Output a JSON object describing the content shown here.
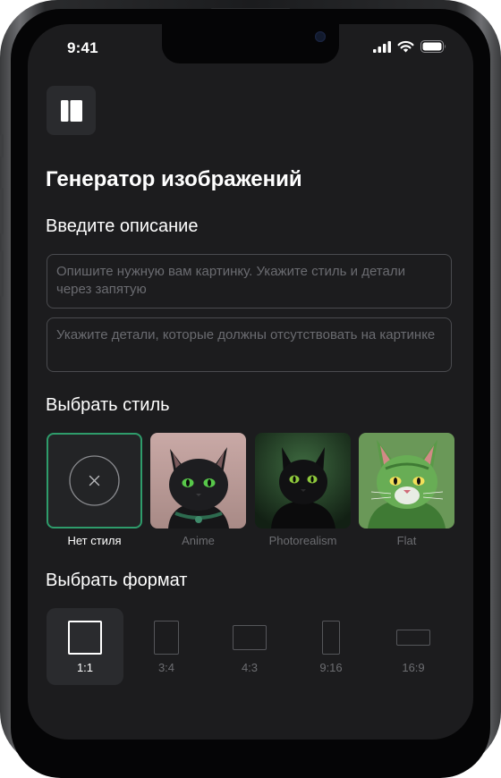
{
  "status": {
    "time": "9:41"
  },
  "header": {
    "title": "Генератор изображений"
  },
  "prompt": {
    "label": "Введите описание",
    "description_placeholder": "Опишите нужную вам картинку. Укажите стиль и детали через запятую",
    "negative_placeholder": "Укажите детали, которые должны отсутствовать на картинке"
  },
  "styles": {
    "label": "Выбрать стиль",
    "items": [
      {
        "name": "Нет стиля",
        "selected": true,
        "icon": "close-icon"
      },
      {
        "name": "Anime",
        "selected": false
      },
      {
        "name": "Photorealism",
        "selected": false
      },
      {
        "name": "Flat",
        "selected": false
      }
    ]
  },
  "formats": {
    "label": "Выбрать формат",
    "items": [
      {
        "name": "1:1",
        "selected": true
      },
      {
        "name": "3:4",
        "selected": false
      },
      {
        "name": "4:3",
        "selected": false
      },
      {
        "name": "9:16",
        "selected": false
      },
      {
        "name": "16:9",
        "selected": false
      }
    ]
  },
  "colors": {
    "background": "#1c1c1e",
    "accent": "#2e9c6b",
    "muted_text": "#6c6d71"
  }
}
